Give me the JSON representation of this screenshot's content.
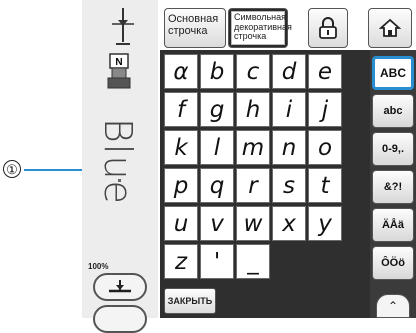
{
  "callout": {
    "number": "①"
  },
  "preview": {
    "text": "Blue",
    "zoom": "100%"
  },
  "top_buttons": {
    "basic": "Основная строчка",
    "decorative": "Символьная декоративная строчка"
  },
  "keyboard": {
    "rows": [
      [
        "α",
        "b",
        "c",
        "d",
        "e"
      ],
      [
        "f",
        "g",
        "h",
        "i",
        "j"
      ],
      [
        "k",
        "l",
        "m",
        "n",
        "o"
      ],
      [
        "p",
        "q",
        "r",
        "s",
        "t"
      ],
      [
        "u",
        "v",
        "w",
        "x",
        "y"
      ],
      [
        "z",
        "'",
        "_"
      ]
    ]
  },
  "close_label": "ЗАКРЫТЬ",
  "side_buttons": [
    "ABC",
    "abc",
    "0-9,.",
    "&?!",
    "ÄÅä",
    "ÔÖö"
  ],
  "active_side": "ABC",
  "colors": {
    "accent": "#2a8fd0",
    "panel": "#2f2f2f"
  }
}
